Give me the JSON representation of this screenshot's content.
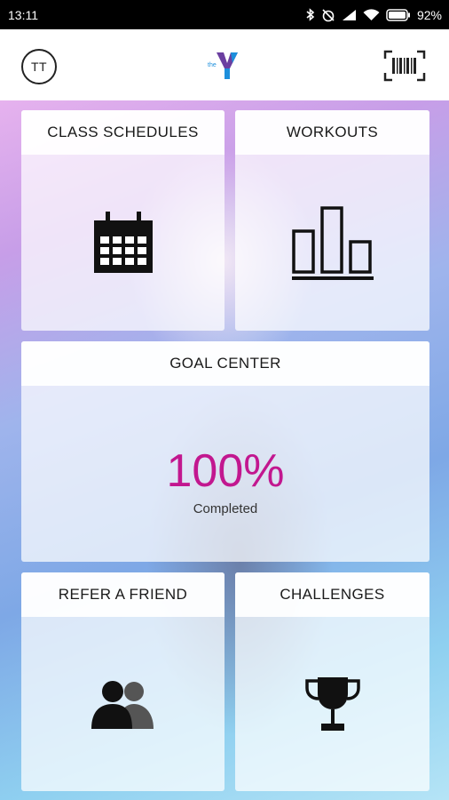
{
  "status_bar": {
    "time": "13:11",
    "battery": "92%",
    "icons": [
      "bluetooth-icon",
      "alarm-off-icon",
      "signal-icon",
      "wifi-icon",
      "battery-icon"
    ]
  },
  "header": {
    "avatar_initials": "TT",
    "logo_icon": "ymca-logo",
    "barcode_icon": "barcode-icon",
    "brand_color": "#1d8fdc"
  },
  "tiles": {
    "class_schedules": {
      "title": "CLASS SCHEDULES",
      "icon": "calendar-icon"
    },
    "workouts": {
      "title": "WORKOUTS",
      "icon": "bar-chart-icon"
    },
    "goal_center": {
      "title": "GOAL CENTER",
      "percent": "100%",
      "caption": "Completed",
      "accent": "#c2178f"
    },
    "refer_friend": {
      "title": "REFER A FRIEND",
      "icon": "people-icon"
    },
    "challenges": {
      "title": "CHALLENGES",
      "icon": "trophy-icon"
    }
  }
}
